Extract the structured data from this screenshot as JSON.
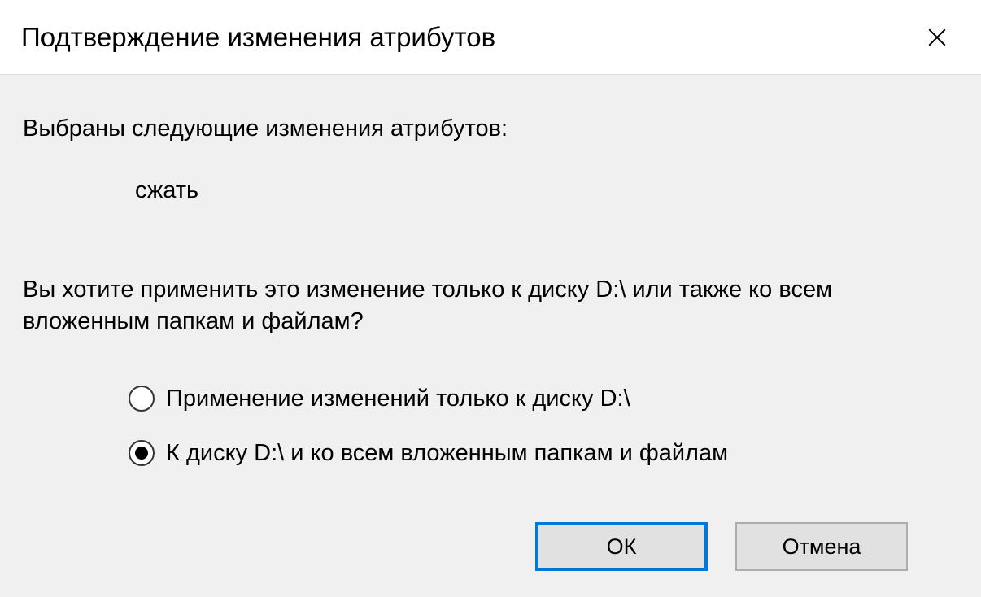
{
  "titlebar": {
    "title": "Подтверждение изменения атрибутов"
  },
  "content": {
    "intro": "Выбраны следующие изменения атрибутов:",
    "attribute": "сжать",
    "question": "Вы хотите применить это изменение только к диску D:\\ или также ко всем вложенным папкам и файлам?"
  },
  "radios": {
    "option1": "Применение изменений только к диску D:\\",
    "option2": "К диску D:\\ и ко всем вложенным папкам и файлам",
    "selected": 1
  },
  "buttons": {
    "ok": "ОК",
    "cancel": "Отмена"
  }
}
